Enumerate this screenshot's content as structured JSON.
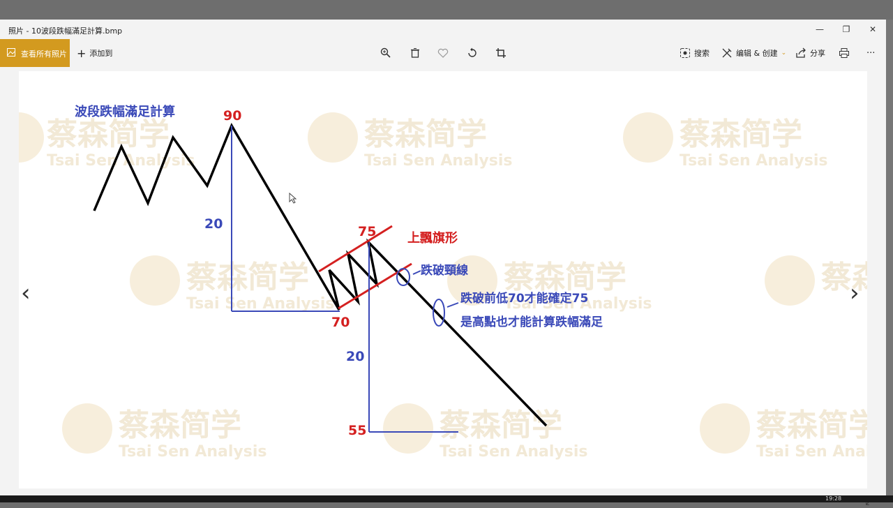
{
  "window": {
    "title": "照片 - 10波段跌幅滿足計算.bmp",
    "minimize": "—",
    "maximize": "❐",
    "close": "✕"
  },
  "toolbar": {
    "view_all": "查看所有照片",
    "add_to": "添加到",
    "search": "搜索",
    "edit_create": "编辑 & 创建",
    "share": "分享",
    "more": "···"
  },
  "image": {
    "title": "波段跌幅滿足計算",
    "top_value": "90",
    "drop_left": "20",
    "low_value": "70",
    "flag_high": "75",
    "flag_label": "上飄旗形",
    "neckline_label": "跌破頸線",
    "note_line1": "跌破前低70才能確定75",
    "note_line2": "是高點也才能計算跌幅滿足",
    "drop_right": "20",
    "target_value": "55",
    "watermark_cn": "蔡森简学",
    "watermark_en": "Tsai Sen Analysis"
  },
  "colors": {
    "accent": "#d39a1f",
    "blue": "#3a49b8",
    "red": "#d42020",
    "watermark": "#f1e7d2"
  },
  "taskbar": {
    "time": "19:28"
  }
}
